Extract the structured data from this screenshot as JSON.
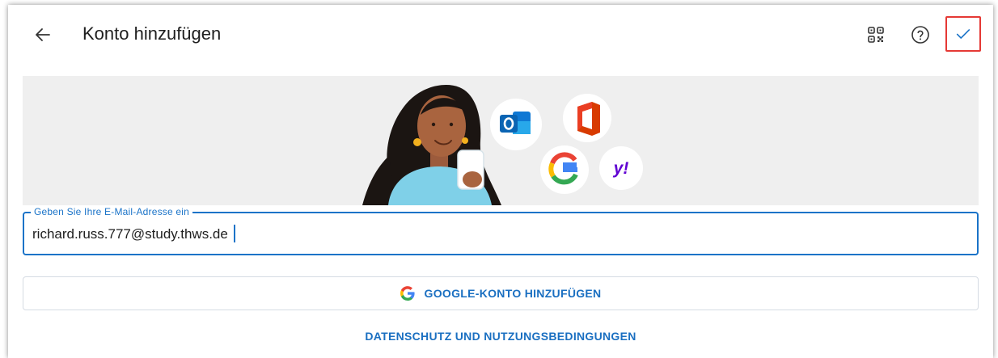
{
  "header": {
    "title": "Konto hinzufügen",
    "icons": {
      "back": "arrow-left-icon",
      "qr": "qr-code-icon",
      "help": "help-circle-icon",
      "confirm": "check-icon"
    }
  },
  "hero": {
    "providers": [
      "outlook-icon",
      "office-icon",
      "google-icon",
      "yahoo-icon"
    ],
    "yahoo_text": "y!"
  },
  "email": {
    "label": "Geben Sie Ihre E-Mail-Adresse ein",
    "value": "richard.russ.777@study.thws.de"
  },
  "google_button": {
    "label": "GOOGLE-KONTO HINZUFÜGEN"
  },
  "privacy_link": {
    "label": "DATENSCHUTZ UND NUTZUNGSBEDINGUNGEN"
  },
  "colors": {
    "accent": "#1a73c8",
    "highlight": "#e53935",
    "hero_bg": "#efefef"
  }
}
